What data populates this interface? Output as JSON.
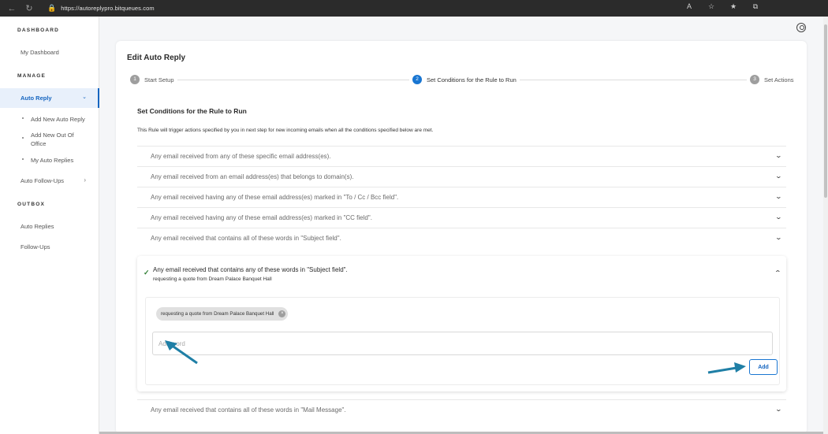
{
  "browser": {
    "url": "https://autoreplypro.bitqueues.com",
    "icons": [
      "back-icon",
      "refresh-icon",
      "lock-icon",
      "read-aloud-icon",
      "favorite-add-icon",
      "favorites-icon",
      "collections-icon"
    ]
  },
  "sidebar": {
    "dashboard_heading": "DASHBOARD",
    "my_dashboard": "My Dashboard",
    "manage_heading": "MANAGE",
    "auto_reply": "Auto Reply",
    "sub_items": [
      "Add New Auto Reply",
      "Add New Out Of Office",
      "My Auto Replies"
    ],
    "auto_followups": "Auto Follow-Ups",
    "outbox_heading": "OUTBOX",
    "auto_replies": "Auto Replies",
    "followups": "Follow-Ups"
  },
  "main": {
    "title": "Edit Auto Reply",
    "steps": [
      {
        "num": "1",
        "label": "Start Setup"
      },
      {
        "num": "2",
        "label": "Set Conditions for the Rule to Run"
      },
      {
        "num": "3",
        "label": "Set Actions"
      }
    ],
    "section_title": "Set Conditions for the Rule to Run",
    "section_desc": "This Rule will trigger actions specified by you in next step for new incoming emails when all the conditions specified below are met.",
    "conditions": [
      "Any email received from any of these specific email address(es).",
      "Any email received from an email address(es) that belongs to domain(s).",
      "Any email received having any of these email address(es) marked in \"To / Cc / Bcc field\".",
      "Any email received having any of these email address(es) marked in \"CC field\".",
      "Any email received that contains all of these words in \"Subject field\"."
    ],
    "expanded": {
      "title": "Any email received that contains any of these words in \"Subject field\".",
      "subtitle": "requesting a quote from Dream Palace Banquet Hall",
      "chip": "requesting a quote from Dream Palace Banquet Hall",
      "input_placeholder": "Add word",
      "input_value": "",
      "add_label": "Add"
    },
    "last_condition": "Any email received that contains all of these words in \"Mail Message\"."
  },
  "colors": {
    "accent": "#1976d2",
    "check": "#2e7d32",
    "arrow": "#1f7fa6"
  }
}
